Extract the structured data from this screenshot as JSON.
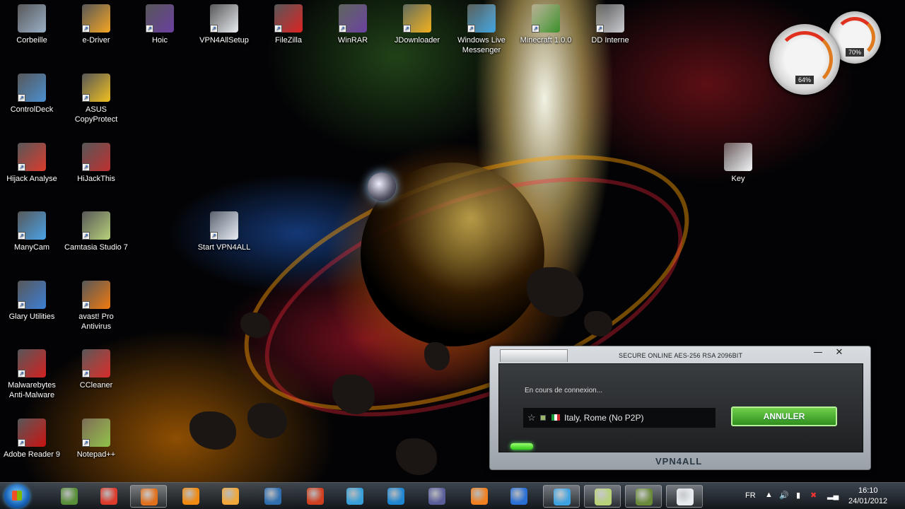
{
  "desktop": {
    "icons": [
      {
        "label": "Corbeille",
        "icon": "recycle-bin-icon",
        "color": "#9ab0c8"
      },
      {
        "label": "e-Driver",
        "icon": "e-driver-icon",
        "color": "#f5a623"
      },
      {
        "label": "Hoic",
        "icon": "winrar-archive-icon",
        "color": "#6b3fa0"
      },
      {
        "label": "VPN4AllSetup",
        "icon": "vpn4all-icon",
        "color": "#e8ecf0"
      },
      {
        "label": "FileZilla",
        "icon": "filezilla-icon",
        "color": "#d22"
      },
      {
        "label": "WinRAR",
        "icon": "winrar-icon",
        "color": "#6b3fa0"
      },
      {
        "label": "JDownloader",
        "icon": "jdownloader-icon",
        "color": "#f2b01e"
      },
      {
        "label": "Windows Live Messenger",
        "icon": "messenger-icon",
        "color": "#3fa2e0"
      },
      {
        "label": "Minecraft 1.0.0",
        "icon": "minecraft-tree-icon",
        "color": "#3a8f2a"
      },
      {
        "label": "DD Interne",
        "icon": "hard-drive-icon",
        "color": "#c8ccd0"
      },
      {
        "label": "ControlDeck",
        "icon": "controldeck-icon",
        "color": "#4b8fd0"
      },
      {
        "label": "ASUS CopyProtect",
        "icon": "asus-copyprotect-icon",
        "color": "#f0c020"
      },
      {
        "label": "Hijack Analyse",
        "icon": "chrome-icon",
        "color": "#dd3b2c"
      },
      {
        "label": "HiJackThis",
        "icon": "hijackthis-icon",
        "color": "#c03030"
      },
      {
        "label": "ManyCam",
        "icon": "manycam-icon",
        "color": "#4aa3e8"
      },
      {
        "label": "Camtasia Studio 7",
        "icon": "camtasia-icon",
        "color": "#b8d27a"
      },
      {
        "label": "Start VPN4ALL",
        "icon": "vpn4all-icon",
        "color": "#e8ecf0"
      },
      {
        "label": "Glary Utilities",
        "icon": "glary-utilities-icon",
        "color": "#3d7fd6"
      },
      {
        "label": "avast! Pro Antivirus",
        "icon": "avast-icon",
        "color": "#f07a10"
      },
      {
        "label": "Malwarebytes Anti-Malware",
        "icon": "malwarebytes-icon",
        "color": "#d42020"
      },
      {
        "label": "CCleaner",
        "icon": "ccleaner-icon",
        "color": "#d62a2a"
      },
      {
        "label": "Adobe Reader 9",
        "icon": "adobe-reader-icon",
        "color": "#c81010"
      },
      {
        "label": "Notepad++",
        "icon": "notepadpp-icon",
        "color": "#8fc04a"
      },
      {
        "label": "Key",
        "icon": "text-file-icon",
        "color": "#f4f6f8"
      }
    ]
  },
  "gadgets": {
    "cpu_value": "64%",
    "ram_value": "70%"
  },
  "vpn_window": {
    "title": "SECURE ONLINE AES-256 RSA 2096BIT",
    "minimize": "—",
    "close": "✕",
    "status": "En cours de connexion...",
    "server": "Italy, Rome (No P2P)",
    "cancel_label": "ANNULER",
    "brand": "VPN4ALL",
    "progress_fraction": 0.06
  },
  "taskbar": {
    "apps": [
      {
        "icon": "minecraft-icon",
        "color": "#5a8f3a"
      },
      {
        "icon": "chrome-icon",
        "color": "#dd3b2c"
      },
      {
        "icon": "firefox-icon",
        "color": "#e0701c",
        "active": true
      },
      {
        "icon": "vlc-icon",
        "color": "#f08a10"
      },
      {
        "icon": "media-player-icon",
        "color": "#f2a83a"
      },
      {
        "icon": "steam-icon",
        "color": "#2f6fb0"
      },
      {
        "icon": "avast-icon",
        "color": "#d04020"
      },
      {
        "icon": "color-palette-icon",
        "color": "#38a0d8"
      },
      {
        "icon": "photoshop-icon",
        "color": "#1f86d1"
      },
      {
        "icon": "after-effects-icon",
        "color": "#5a5f9a"
      },
      {
        "icon": "blender-icon",
        "color": "#f08020"
      },
      {
        "icon": "globe-icon",
        "color": "#2a6fd6"
      },
      {
        "icon": "messenger-icon",
        "color": "#3fa2e0",
        "active": true
      },
      {
        "icon": "camtasia-icon",
        "color": "#b8d27a",
        "active": true
      },
      {
        "icon": "camtasia-recorder-icon",
        "color": "#6a8a3a",
        "active": true
      },
      {
        "icon": "vpn4all-icon",
        "color": "#e8ecf0",
        "active": true
      }
    ],
    "language": "FR",
    "time": "16:10",
    "date": "24/01/2012"
  }
}
